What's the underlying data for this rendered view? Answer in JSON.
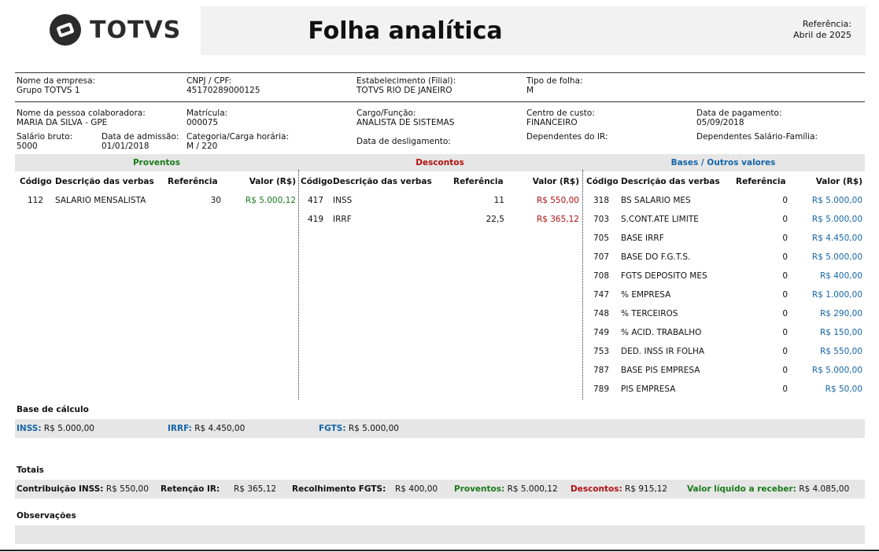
{
  "header": {
    "logo_text": "TOTVS",
    "title": "Folha analítica",
    "ref_label": "Referência:",
    "ref_value": "Abril de 2025"
  },
  "company": {
    "name_label": "Nome da empresa:",
    "name": "Grupo TOTVS 1",
    "cnpj_label": "CNPJ / CPF:",
    "cnpj": "45170289000125",
    "estab_label": "Estabelecimento (Filial):",
    "estab": "TOTVS RIO DE JANEIRO",
    "tipo_label": "Tipo de folha:",
    "tipo": "M"
  },
  "employee": {
    "name_label": "Nome da pessoa colaboradora:",
    "name": "MARIA DA SILVA - GPE",
    "matricula_label": "Matrícula:",
    "matricula": "000075",
    "cargo_label": "Cargo/Função:",
    "cargo": "ANALISTA DE SISTEMAS",
    "centro_label": "Centro de custo:",
    "centro": "FINANCEIRO",
    "pagamento_label": "Data de pagamento:",
    "pagamento": "05/09/2018",
    "salario_label": "Salário bruto:",
    "salario": "5000",
    "admissao_label": "Data de admissão:",
    "admissao": "01/01/2018",
    "categoria_label": "Categoria/Carga horária:",
    "categoria": "M / 220",
    "desligamento_label": "Data de desligamento:",
    "dep_ir_label": "Dependentes do IR:",
    "dep_sf_label": "Dependentes Salário-Família:"
  },
  "sections": {
    "proventos": "Proventos",
    "descontos": "Descontos",
    "bases": "Bases / Outros valores"
  },
  "columns": {
    "codigo": "Código",
    "descricao": "Descrição das verbas",
    "referencia": "Referência",
    "valor": "Valor (R$)"
  },
  "proventos": [
    {
      "codigo": "112",
      "descricao": "SALARIO MENSALISTA",
      "referencia": "30",
      "valor": "R$ 5.000,12"
    }
  ],
  "descontos": [
    {
      "codigo": "417",
      "descricao": "INSS",
      "referencia": "11",
      "valor": "R$ 550,00"
    },
    {
      "codigo": "419",
      "descricao": "IRRF",
      "referencia": "22,5",
      "valor": "R$ 365,12"
    }
  ],
  "bases": [
    {
      "codigo": "318",
      "descricao": "BS SALARIO MES",
      "referencia": "0",
      "valor": "R$ 5.000,00"
    },
    {
      "codigo": "703",
      "descricao": "S.CONT.ATE LIMITE",
      "referencia": "0",
      "valor": "R$ 5.000,00"
    },
    {
      "codigo": "705",
      "descricao": "BASE IRRF",
      "referencia": "0",
      "valor": "R$ 4.450,00"
    },
    {
      "codigo": "707",
      "descricao": "BASE DO F.G.T.S.",
      "referencia": "0",
      "valor": "R$ 5.000,00"
    },
    {
      "codigo": "708",
      "descricao": "FGTS DEPOSITO MES",
      "referencia": "0",
      "valor": "R$ 400,00"
    },
    {
      "codigo": "747",
      "descricao": "% EMPRESA",
      "referencia": "0",
      "valor": "R$ 1.000,00"
    },
    {
      "codigo": "748",
      "descricao": "% TERCEIROS",
      "referencia": "0",
      "valor": "R$ 290,00"
    },
    {
      "codigo": "749",
      "descricao": "% ACID. TRABALHO",
      "referencia": "0",
      "valor": "R$ 150,00"
    },
    {
      "codigo": "753",
      "descricao": "DED. INSS IR FOLHA",
      "referencia": "0",
      "valor": "R$ 550,00"
    },
    {
      "codigo": "787",
      "descricao": "BASE PIS EMPRESA",
      "referencia": "0",
      "valor": "R$ 5.000,00"
    },
    {
      "codigo": "789",
      "descricao": "PIS EMPRESA",
      "referencia": "0",
      "valor": "R$ 50,00"
    }
  ],
  "base_calculo": {
    "title": "Base de cálculo",
    "inss_label": "INSS:",
    "inss": "R$ 5.000,00",
    "irrf_label": "IRRF:",
    "irrf": "R$ 4.450,00",
    "fgts_label": "FGTS:",
    "fgts": "R$ 5.000,00"
  },
  "totais": {
    "title": "Totais",
    "contrib_label": "Contribuição INSS:",
    "contrib": "R$ 550,00",
    "retencao_label": "Retenção IR:",
    "retencao": "R$ 365,12",
    "recolh_label": "Recolhimento FGTS:",
    "recolh": "R$ 400,00",
    "proventos_label": "Proventos:",
    "proventos": "R$ 5.000,12",
    "descontos_label": "Descontos:",
    "descontos": "R$ 915,12",
    "liquido_label": "Valor líquido a receber:",
    "liquido": "R$ 4.085,00"
  },
  "observacoes": {
    "title": "Observações"
  },
  "colors": {
    "green": "#1a7a1a",
    "red": "#b01010",
    "blue": "#1565a8"
  }
}
